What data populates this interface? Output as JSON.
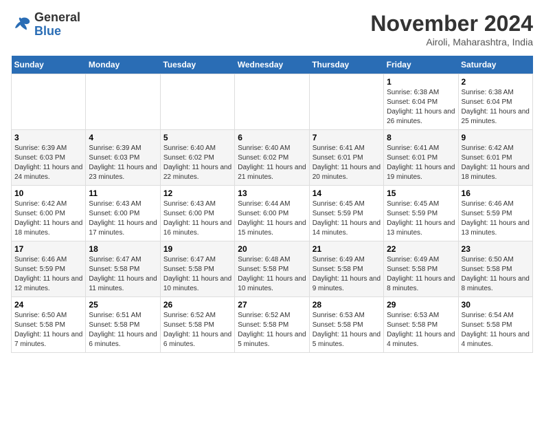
{
  "header": {
    "logo_general": "General",
    "logo_blue": "Blue",
    "title": "November 2024",
    "location": "Airoli, Maharashtra, India"
  },
  "weekdays": [
    "Sunday",
    "Monday",
    "Tuesday",
    "Wednesday",
    "Thursday",
    "Friday",
    "Saturday"
  ],
  "weeks": [
    [
      {
        "day": "",
        "info": ""
      },
      {
        "day": "",
        "info": ""
      },
      {
        "day": "",
        "info": ""
      },
      {
        "day": "",
        "info": ""
      },
      {
        "day": "",
        "info": ""
      },
      {
        "day": "1",
        "info": "Sunrise: 6:38 AM\nSunset: 6:04 PM\nDaylight: 11 hours and 26 minutes."
      },
      {
        "day": "2",
        "info": "Sunrise: 6:38 AM\nSunset: 6:04 PM\nDaylight: 11 hours and 25 minutes."
      }
    ],
    [
      {
        "day": "3",
        "info": "Sunrise: 6:39 AM\nSunset: 6:03 PM\nDaylight: 11 hours and 24 minutes."
      },
      {
        "day": "4",
        "info": "Sunrise: 6:39 AM\nSunset: 6:03 PM\nDaylight: 11 hours and 23 minutes."
      },
      {
        "day": "5",
        "info": "Sunrise: 6:40 AM\nSunset: 6:02 PM\nDaylight: 11 hours and 22 minutes."
      },
      {
        "day": "6",
        "info": "Sunrise: 6:40 AM\nSunset: 6:02 PM\nDaylight: 11 hours and 21 minutes."
      },
      {
        "day": "7",
        "info": "Sunrise: 6:41 AM\nSunset: 6:01 PM\nDaylight: 11 hours and 20 minutes."
      },
      {
        "day": "8",
        "info": "Sunrise: 6:41 AM\nSunset: 6:01 PM\nDaylight: 11 hours and 19 minutes."
      },
      {
        "day": "9",
        "info": "Sunrise: 6:42 AM\nSunset: 6:01 PM\nDaylight: 11 hours and 18 minutes."
      }
    ],
    [
      {
        "day": "10",
        "info": "Sunrise: 6:42 AM\nSunset: 6:00 PM\nDaylight: 11 hours and 18 minutes."
      },
      {
        "day": "11",
        "info": "Sunrise: 6:43 AM\nSunset: 6:00 PM\nDaylight: 11 hours and 17 minutes."
      },
      {
        "day": "12",
        "info": "Sunrise: 6:43 AM\nSunset: 6:00 PM\nDaylight: 11 hours and 16 minutes."
      },
      {
        "day": "13",
        "info": "Sunrise: 6:44 AM\nSunset: 6:00 PM\nDaylight: 11 hours and 15 minutes."
      },
      {
        "day": "14",
        "info": "Sunrise: 6:45 AM\nSunset: 5:59 PM\nDaylight: 11 hours and 14 minutes."
      },
      {
        "day": "15",
        "info": "Sunrise: 6:45 AM\nSunset: 5:59 PM\nDaylight: 11 hours and 13 minutes."
      },
      {
        "day": "16",
        "info": "Sunrise: 6:46 AM\nSunset: 5:59 PM\nDaylight: 11 hours and 13 minutes."
      }
    ],
    [
      {
        "day": "17",
        "info": "Sunrise: 6:46 AM\nSunset: 5:59 PM\nDaylight: 11 hours and 12 minutes."
      },
      {
        "day": "18",
        "info": "Sunrise: 6:47 AM\nSunset: 5:58 PM\nDaylight: 11 hours and 11 minutes."
      },
      {
        "day": "19",
        "info": "Sunrise: 6:47 AM\nSunset: 5:58 PM\nDaylight: 11 hours and 10 minutes."
      },
      {
        "day": "20",
        "info": "Sunrise: 6:48 AM\nSunset: 5:58 PM\nDaylight: 11 hours and 10 minutes."
      },
      {
        "day": "21",
        "info": "Sunrise: 6:49 AM\nSunset: 5:58 PM\nDaylight: 11 hours and 9 minutes."
      },
      {
        "day": "22",
        "info": "Sunrise: 6:49 AM\nSunset: 5:58 PM\nDaylight: 11 hours and 8 minutes."
      },
      {
        "day": "23",
        "info": "Sunrise: 6:50 AM\nSunset: 5:58 PM\nDaylight: 11 hours and 8 minutes."
      }
    ],
    [
      {
        "day": "24",
        "info": "Sunrise: 6:50 AM\nSunset: 5:58 PM\nDaylight: 11 hours and 7 minutes."
      },
      {
        "day": "25",
        "info": "Sunrise: 6:51 AM\nSunset: 5:58 PM\nDaylight: 11 hours and 6 minutes."
      },
      {
        "day": "26",
        "info": "Sunrise: 6:52 AM\nSunset: 5:58 PM\nDaylight: 11 hours and 6 minutes."
      },
      {
        "day": "27",
        "info": "Sunrise: 6:52 AM\nSunset: 5:58 PM\nDaylight: 11 hours and 5 minutes."
      },
      {
        "day": "28",
        "info": "Sunrise: 6:53 AM\nSunset: 5:58 PM\nDaylight: 11 hours and 5 minutes."
      },
      {
        "day": "29",
        "info": "Sunrise: 6:53 AM\nSunset: 5:58 PM\nDaylight: 11 hours and 4 minutes."
      },
      {
        "day": "30",
        "info": "Sunrise: 6:54 AM\nSunset: 5:58 PM\nDaylight: 11 hours and 4 minutes."
      }
    ]
  ]
}
